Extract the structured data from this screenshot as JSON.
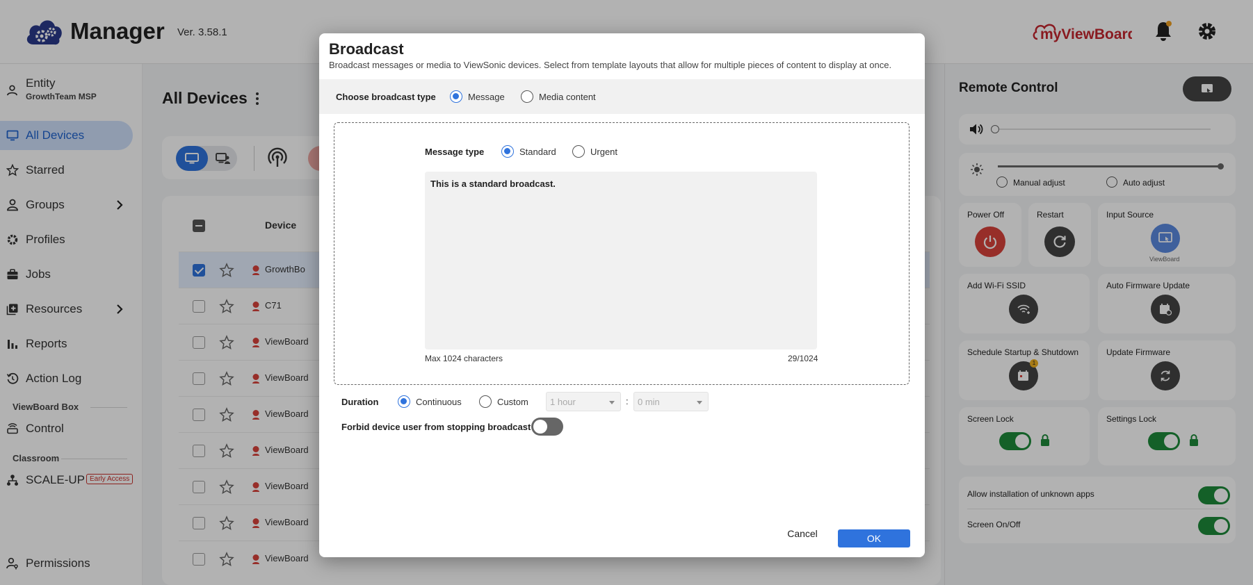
{
  "header": {
    "app_name": "Manager",
    "version": "Ver. 3.58.1",
    "brand": "myViewBoard",
    "notification_dot_color": "#f0a020"
  },
  "sidebar": {
    "entity": {
      "label": "Entity",
      "name": "GrowthTeam MSP"
    },
    "items": [
      {
        "label": "All Devices",
        "icon": "monitor-icon"
      },
      {
        "label": "Starred",
        "icon": "star-icon"
      },
      {
        "label": "Groups",
        "icon": "person-icon"
      },
      {
        "label": "Profiles",
        "icon": "gear-icon"
      },
      {
        "label": "Jobs",
        "icon": "briefcase-icon"
      },
      {
        "label": "Resources",
        "icon": "plus-box-icon"
      },
      {
        "label": "Reports",
        "icon": "bar-chart-icon"
      },
      {
        "label": "Action Log",
        "icon": "history-icon"
      },
      {
        "label": "Control",
        "icon": "router-icon"
      },
      {
        "label": "SCALE-UP",
        "icon": "hierarchy-icon"
      },
      {
        "label": "Permissions",
        "icon": "user-key-icon"
      }
    ],
    "sections": {
      "viewboard_box": "ViewBoard Box",
      "classroom": "Classroom"
    },
    "early_access": "Early Access"
  },
  "main": {
    "title": "All Devices",
    "table_header": {
      "device": "Device"
    },
    "rows": [
      {
        "name": "GrowthBo",
        "selected": true
      },
      {
        "name": "C71",
        "selected": false
      },
      {
        "name": "ViewBoard",
        "selected": false
      },
      {
        "name": "ViewBoard",
        "selected": false
      },
      {
        "name": "ViewBoard",
        "selected": false
      },
      {
        "name": "ViewBoard",
        "selected": false
      },
      {
        "name": "ViewBoard",
        "selected": false
      },
      {
        "name": "ViewBoard",
        "selected": false
      },
      {
        "name": "ViewBoard",
        "selected": false
      }
    ]
  },
  "remote": {
    "title": "Remote Control",
    "brightness": {
      "manual": "Manual adjust",
      "auto": "Auto adjust"
    },
    "power_off": "Power Off",
    "restart": "Restart",
    "input_source": "Input Source",
    "input_source_value": "ViewBoard",
    "add_wifi": "Add Wi-Fi SSID",
    "auto_firmware": "Auto Firmware Update",
    "schedule": "Schedule Startup & Shutdown",
    "schedule_badge": "1",
    "update_firmware": "Update Firmware",
    "screen_lock": "Screen Lock",
    "settings_lock": "Settings Lock",
    "allow_unknown": "Allow installation of unknown apps",
    "screen_onoff": "Screen On/Off"
  },
  "modal": {
    "title": "Broadcast",
    "subtitle": "Broadcast messages or media to ViewSonic devices. Select from template layouts that allow for multiple pieces of content to display at once.",
    "type_label": "Choose broadcast type",
    "type_options": [
      "Message",
      "Media content"
    ],
    "message_type_label": "Message type",
    "message_type_options": [
      "Standard",
      "Urgent"
    ],
    "message": "This is a standard broadcast.",
    "max_chars": "Max 1024 characters",
    "char_count": "29/1024",
    "duration_label": "Duration",
    "duration_options": [
      "Continuous",
      "Custom"
    ],
    "hour_value": "1 hour",
    "time_sep": ":",
    "min_value": "0 min",
    "forbid_label": "Forbid device user from stopping broadcast",
    "cancel": "Cancel",
    "ok": "OK"
  },
  "colors": {
    "accent": "#2f73dd",
    "danger": "#d9423c",
    "success": "#1d8a3a"
  }
}
